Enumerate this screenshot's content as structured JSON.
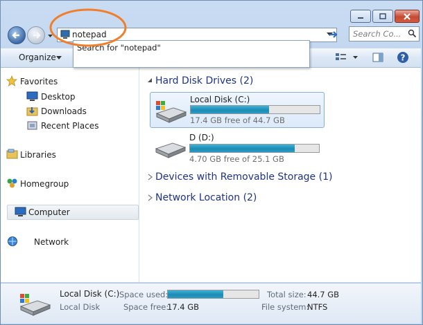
{
  "address": {
    "value": "notepad",
    "suggestion": "Search for \"notepad\""
  },
  "search": {
    "placeholder": "Search Co..."
  },
  "toolbar": {
    "organize_label": "Organize"
  },
  "nav": {
    "favorites": "Favorites",
    "desktop": "Desktop",
    "downloads": "Downloads",
    "recent_places": "Recent Places",
    "libraries": "Libraries",
    "homegroup": "Homegroup",
    "computer": "Computer",
    "network": "Network"
  },
  "content": {
    "hard_disk_header": "Hard Disk Drives (2)",
    "removable_header": "Devices with Removable Storage (1)",
    "network_header": "Network Location (2)",
    "drives": [
      {
        "name": "Local Disk (C:)",
        "free_text": "17.4 GB free of 44.7 GB",
        "used_fraction": 0.61
      },
      {
        "name": "D (D:)",
        "free_text": "4.70 GB free of 25.1 GB",
        "used_fraction": 0.81
      }
    ]
  },
  "details": {
    "name": "Local Disk (C:)",
    "type": "Local Disk",
    "space_used_label": "Space used:",
    "space_free_label": "Space free:",
    "space_free_value": "17.4 GB",
    "total_size_label": "Total size:",
    "total_size_value": "44.7 GB",
    "file_system_label": "File system:",
    "file_system_value": "NTFS",
    "used_fraction": 0.61
  },
  "colors": {
    "annotation": "#f07e2a",
    "accent": "#1d8bb5",
    "group_header": "#1e3287"
  }
}
